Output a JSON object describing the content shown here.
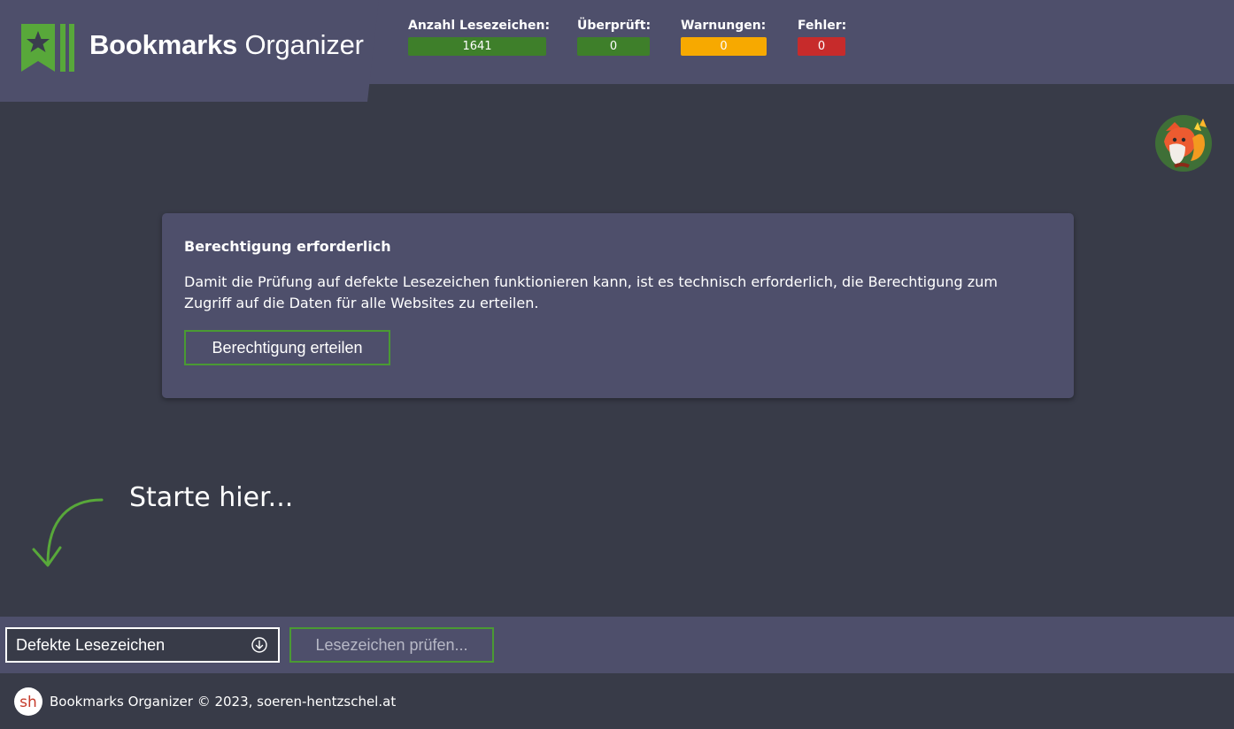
{
  "app": {
    "title_bold": "Bookmarks",
    "title_light": "Organizer"
  },
  "stats": [
    {
      "label": "Anzahl Lesezeichen:",
      "value": "1641",
      "color": "#3e7f2a"
    },
    {
      "label": "Überprüft:",
      "value": "0",
      "color": "#3e7f2a"
    },
    {
      "label": "Warnungen:",
      "value": "0",
      "color": "#f7a900"
    },
    {
      "label": "Fehler:",
      "value": "0",
      "color": "#c72b2b"
    }
  ],
  "permission_card": {
    "title": "Berechtigung erforderlich",
    "text": "Damit die Prüfung auf defekte Lesezeichen funktionieren kann, ist es technisch erforderlich, die Berechtigung zum Zugriff auf die Daten für alle Websites zu erteilen.",
    "button_label": "Berechtigung erteilen"
  },
  "start_hint": "Starte hier...",
  "toolbar": {
    "select_value": "Defekte Lesezeichen",
    "check_button_label": "Lesezeichen prüfen..."
  },
  "footer": {
    "logo_text": "sh",
    "text": "Bookmarks Organizer © 2023, soeren-hentzschel.at"
  },
  "icons": {
    "logo": "bookmark-star-icon",
    "avatar": "fox-avatar-icon",
    "arrow": "curved-arrow-down-icon",
    "select": "circle-arrow-down-icon"
  },
  "colors": {
    "background": "#383b48",
    "panel": "#4e4f6b",
    "accent_green": "#4a9a33"
  }
}
